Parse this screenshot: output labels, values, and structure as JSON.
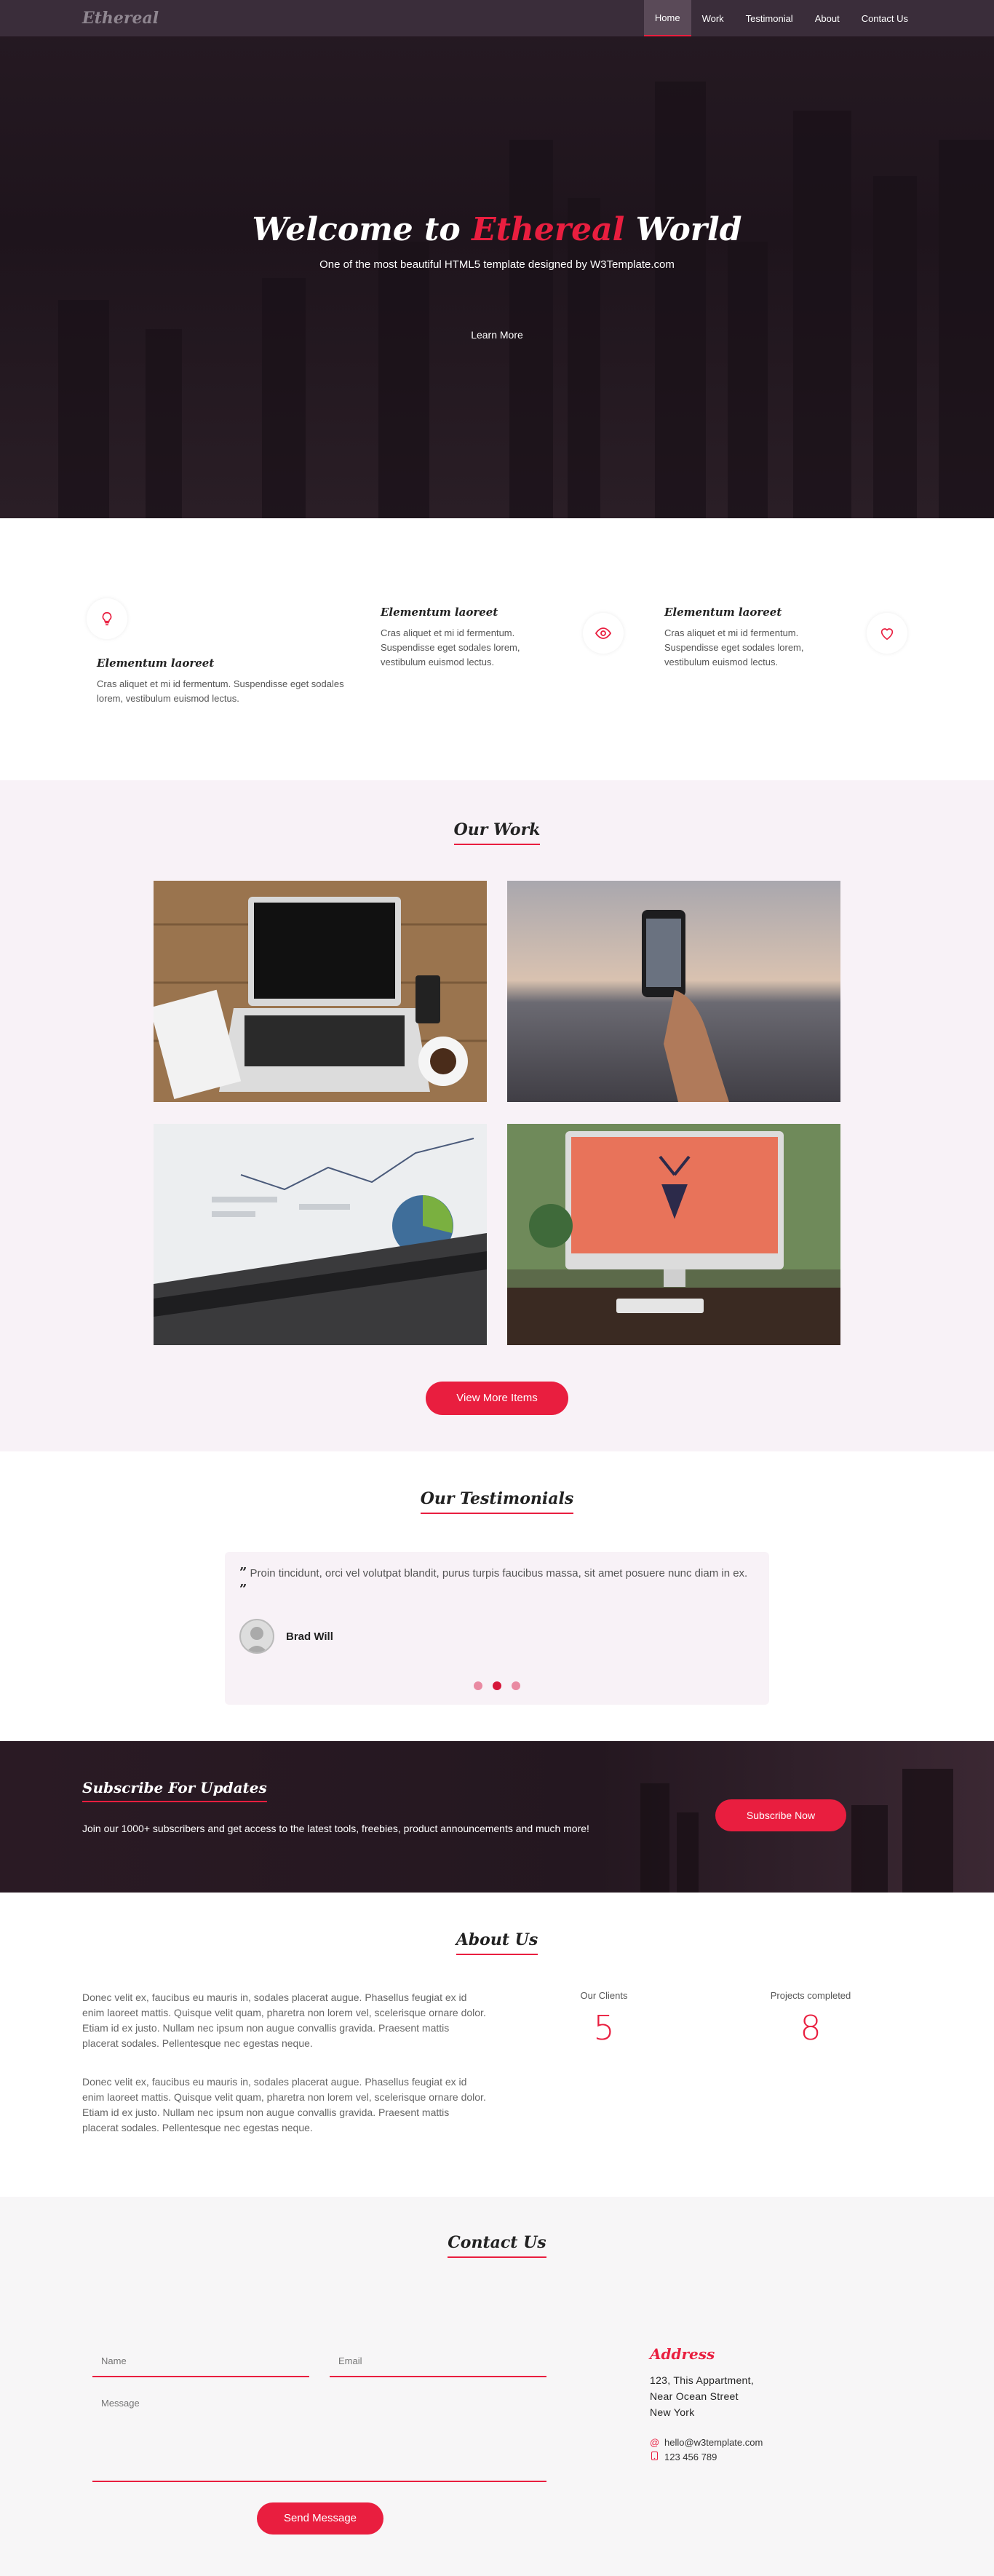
{
  "nav": {
    "brand": "Ethereal",
    "items": [
      {
        "label": "Home",
        "active": true
      },
      {
        "label": "Work",
        "active": false
      },
      {
        "label": "Testimonial",
        "active": false
      },
      {
        "label": "About",
        "active": false
      },
      {
        "label": "Contact Us",
        "active": false
      }
    ]
  },
  "hero": {
    "title_pre": "Welcome to ",
    "title_accent": "Ethereal",
    "title_post": " World",
    "subtitle": "One of the most beautiful HTML5 template designed by W3Template.com",
    "button": "Learn More"
  },
  "features": [
    {
      "icon": "lightbulb-icon",
      "title": "Elementum laoreet",
      "text": "Cras aliquet et mi id fermentum. Suspendisse eget sodales lorem, vestibulum euismod lectus."
    },
    {
      "icon": "eye-icon",
      "title": "Elementum laoreet",
      "text": "Cras aliquet et mi id fermentum. Suspendisse eget sodales lorem, vestibulum euismod lectus."
    },
    {
      "icon": "heart-icon",
      "title": "Elementum laoreet",
      "text": "Cras aliquet et mi id fermentum. Suspendisse eget sodales lorem, vestibulum euismod lectus."
    }
  ],
  "work": {
    "title": "Our Work",
    "button": "View More Items",
    "items": [
      "laptop-desk-photo",
      "phone-sunset-photo",
      "analytics-laptop-photo",
      "imac-deer-photo"
    ]
  },
  "testimonials": {
    "title": "Our Testimonials",
    "quote": "Proin tincidunt, orci vel volutpat blandit, purus turpis faucibus massa, sit amet posuere nunc diam in ex.",
    "open_mark": "”",
    "close_mark": "”",
    "author": "Brad Will",
    "dots": 3,
    "active_dot": 1
  },
  "subscribe": {
    "title": "Subscribe For Updates",
    "text": "Join our 1000+ subscribers and get access to the latest tools, freebies, product announcements and much more!",
    "button": "Subscribe Now"
  },
  "about": {
    "title": "About Us",
    "paragraphs": [
      "Donec velit ex, faucibus eu mauris in, sodales placerat augue. Phasellus feugiat ex id enim laoreet mattis. Quisque velit quam, pharetra non lorem vel, scelerisque ornare dolor. Etiam id ex justo. Nullam nec ipsum non augue convallis gravida. Praesent mattis placerat sodales. Pellentesque nec egestas neque.",
      "Donec velit ex, faucibus eu mauris in, sodales placerat augue. Phasellus feugiat ex id enim laoreet mattis. Quisque velit quam, pharetra non lorem vel, scelerisque ornare dolor. Etiam id ex justo. Nullam nec ipsum non augue convallis gravida. Praesent mattis placerat sodales. Pellentesque nec egestas neque."
    ],
    "stats": [
      {
        "label": "Our Clients",
        "value": "5"
      },
      {
        "label": "Projects completed",
        "value": "8"
      }
    ]
  },
  "contact": {
    "title": "Contact Us",
    "name_placeholder": "Name",
    "email_placeholder": "Email",
    "message_placeholder": "Message",
    "button": "Send Message",
    "address_title": "Address",
    "address_lines": [
      "123, This Appartment,",
      "Near Ocean Street",
      "New York"
    ],
    "email": "hello@w3template.com",
    "phone": "123 456 789"
  },
  "colors": {
    "accent": "#e91e3f",
    "nav_bg": "#3a2d3a",
    "section_tint": "#f8f2f7"
  }
}
